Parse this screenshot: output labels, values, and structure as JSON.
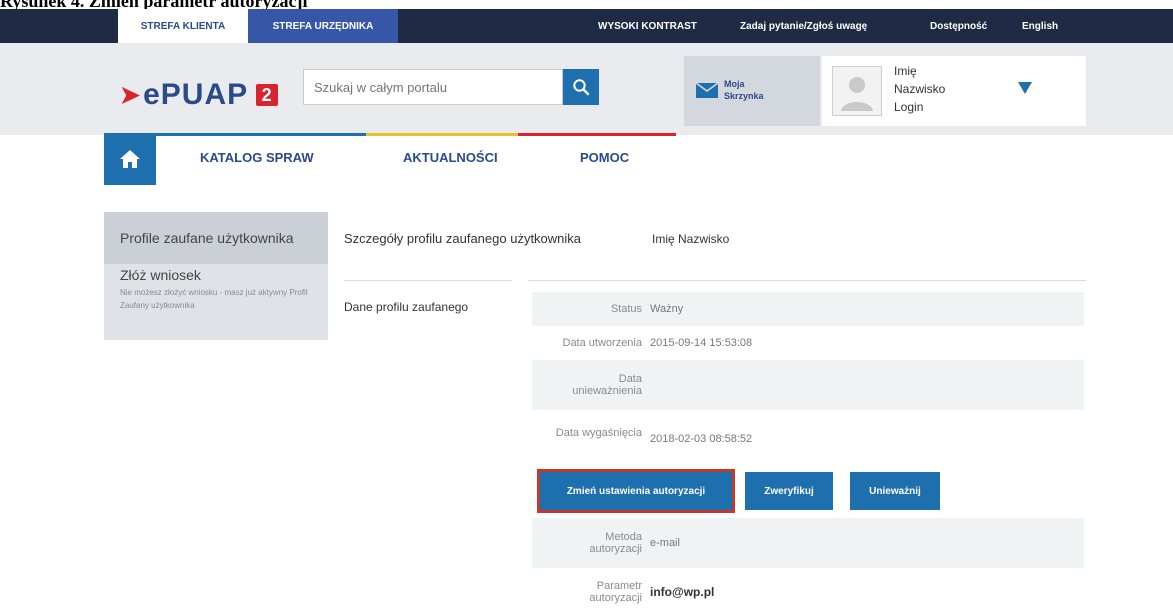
{
  "caption": "Rysunek 4. Zmień parametr autoryzacji",
  "topbar": {
    "tab_client": "STREFA KLIENTA",
    "tab_official": "STREFA URZĘDNIKA",
    "links": [
      "WYSOKI KONTRAST",
      "Zadaj pytanie/Zgłoś uwagę",
      "Dostępność",
      "English"
    ]
  },
  "header": {
    "logo_text": "ePUAP",
    "logo_number": "2",
    "search_placeholder": "Szukaj w całym portalu",
    "mailbox_line1": "Moja",
    "mailbox_line2": "Skrzynka",
    "user_line1": "Imię",
    "user_line2": "Nazwisko",
    "user_line3": "Login"
  },
  "nav": {
    "items": [
      "KATALOG SPRAW",
      "AKTUALNOŚCI",
      "POMOC"
    ],
    "colors": [
      "#1e6fae",
      "#e8c12c",
      "#d8242e"
    ]
  },
  "sidebar": {
    "active_item": "Profile zaufane użytkownika",
    "item": "Złóż wniosek",
    "note": "Nie możesz złożyć wniosku - masz już aktywny Profil Zaufany użytkownika"
  },
  "details": {
    "heading": "Szczegóły profilu zaufanego użytkownika",
    "name": "Imię Nazwisko",
    "section_label": "Dane profilu zaufanego",
    "rows": [
      {
        "label": "Status",
        "value": ""
      },
      {
        "label": "Data utworzenia",
        "value": "2015-09-14 15:53:08"
      },
      {
        "label": "Data unieważnienia",
        "value": ""
      },
      {
        "label": "Data wygaśnięcia",
        "value": "2018-02-03 08:58:52"
      }
    ],
    "status_value": "Ważny",
    "buttons": [
      "Zmień ustawienia autoryzacji",
      "Zweryfikuj",
      "Unieważnij"
    ],
    "auth_rows": [
      {
        "label": "Metoda autoryzacji",
        "value": "e-mail"
      },
      {
        "label": "Parametr autoryzacji",
        "value": "info@wp.pl"
      }
    ]
  },
  "colors": {
    "accent_blue": "#1e6fae",
    "dark_bar": "#1f2a44",
    "highlight_red": "#c0392b"
  }
}
